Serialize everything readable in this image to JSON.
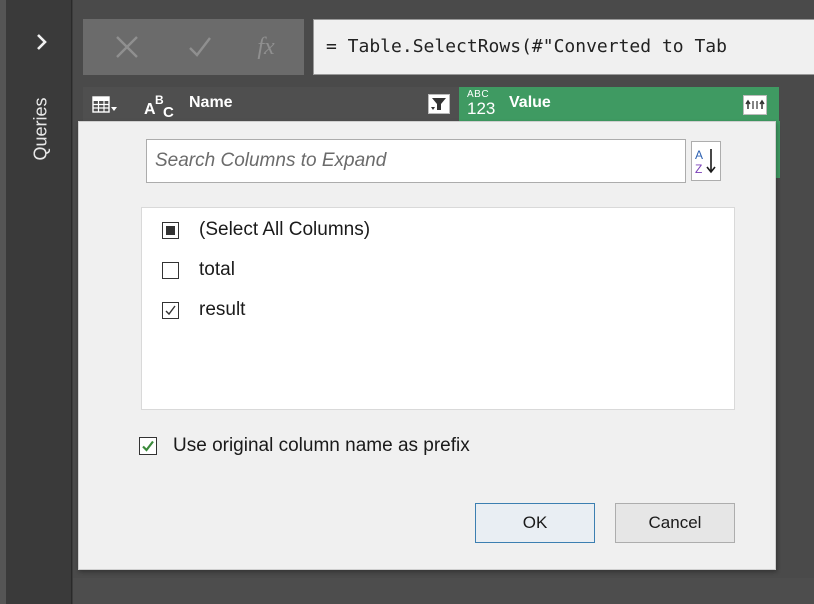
{
  "queries_pane": {
    "label": "Queries",
    "expand_icon": "chevron-right-icon"
  },
  "formula_bar": {
    "cancel_icon": "close-icon",
    "commit_icon": "checkmark-icon",
    "fx_label": "fx",
    "text": "= Table.SelectRows(#\"Converted to Tab"
  },
  "columns": {
    "name": {
      "type_icon": "abc-text-type-icon",
      "label": "Name",
      "filter_icon": "filter-icon"
    },
    "value": {
      "type_top": "ABC",
      "type_bottom": "123",
      "label": "Value",
      "expand_icon": "expand-column-icon",
      "color": "#3f9a62"
    }
  },
  "expand_dialog": {
    "search_placeholder": "Search Columns to Expand",
    "sort_icon": "sort-az-icon",
    "items": [
      {
        "label": "(Select All Columns)",
        "state": "partial"
      },
      {
        "label": "total",
        "state": "unchecked"
      },
      {
        "label": "result",
        "state": "checked"
      }
    ],
    "prefix_label": "Use original column name as prefix",
    "prefix_checked": true,
    "ok_label": "OK",
    "cancel_label": "Cancel",
    "accent": "#3c7fb1"
  }
}
